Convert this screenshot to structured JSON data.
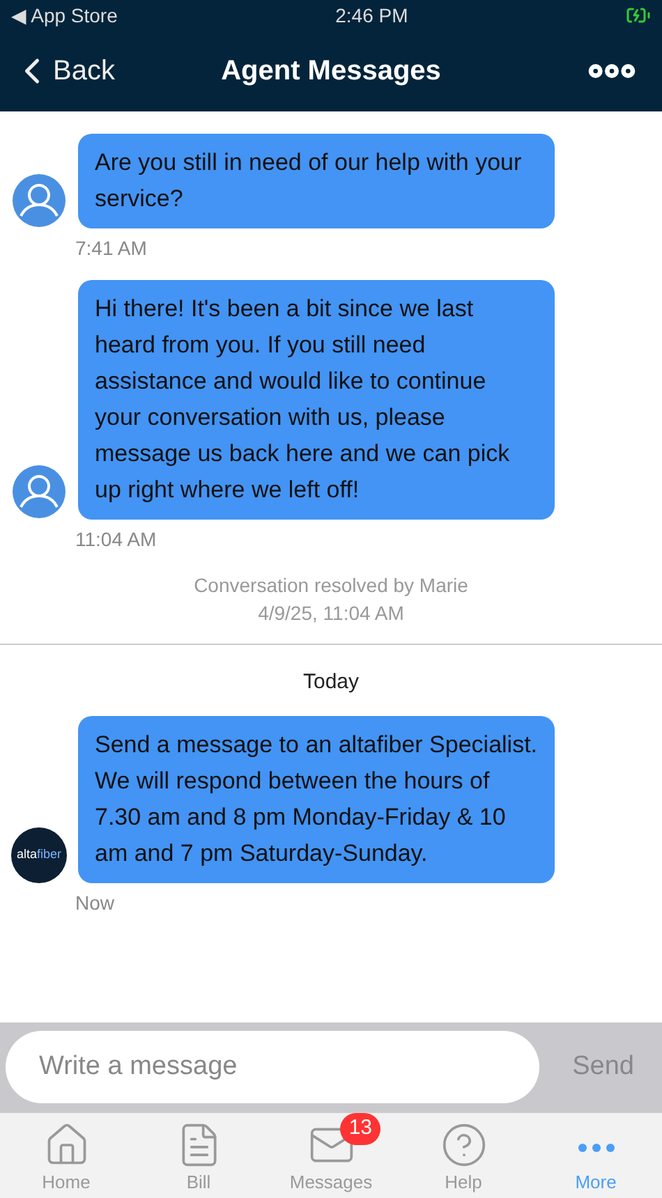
{
  "status_bar": {
    "back_app": "◀ App Store",
    "time": "2:46 PM"
  },
  "header": {
    "back": "Back",
    "title": "Agent Messages"
  },
  "messages": [
    {
      "kind": "agent",
      "text": "Are you still in need of our help with your service?",
      "time": "7:41 AM"
    },
    {
      "kind": "agent",
      "text": "Hi there! It's been a bit since we last heard from you. If you still need assistance and would like to continue your conversation with us, please message us back here and we can pick up right where we left off!",
      "time": "11:04 AM"
    },
    {
      "kind": "notice",
      "lines": [
        "Conversation resolved by Marie",
        "4/9/25, 11:04 AM"
      ]
    },
    {
      "kind": "divider"
    },
    {
      "kind": "day",
      "text": "Today"
    },
    {
      "kind": "agent",
      "logo_text": [
        "alta",
        "fiber"
      ],
      "text": "Send a message to an altafiber Specialist. We will respond between the hours of 7.30 am and 8 pm Monday-Friday & 10 am and 7 pm Saturday-Sunday.",
      "time": "Now"
    }
  ],
  "composer": {
    "placeholder": "Write a message",
    "send": "Send"
  },
  "tabs": [
    {
      "label": "Home",
      "selected": false
    },
    {
      "label": "Bill",
      "selected": false
    },
    {
      "label": "Messages",
      "selected": false,
      "badge": "13"
    },
    {
      "label": "Help",
      "selected": false
    },
    {
      "label": "More",
      "selected": true
    }
  ]
}
